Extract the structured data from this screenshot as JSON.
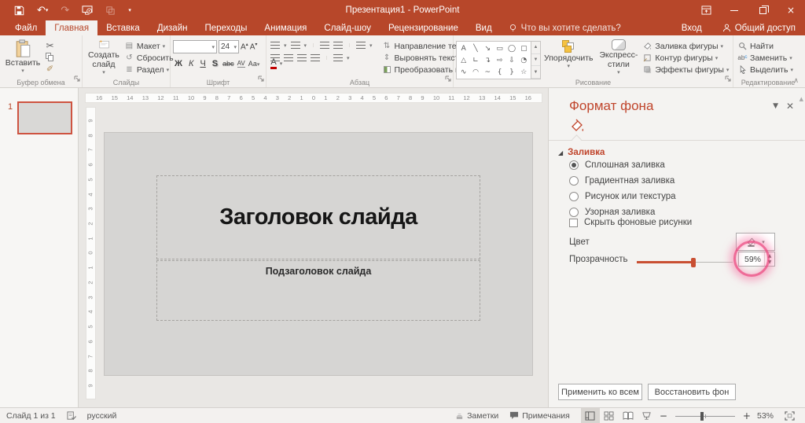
{
  "colors": {
    "accent": "#B7472A",
    "pane_title": "#C0452C",
    "slider_fill": "#C94F32",
    "annotation": "#EC4981"
  },
  "titlebar": {
    "title": "Презентация1 - PowerPoint"
  },
  "tabs": {
    "file": "Файл",
    "items": [
      {
        "label": "Главная",
        "active": true
      },
      {
        "label": "Вставка"
      },
      {
        "label": "Дизайн"
      },
      {
        "label": "Переходы"
      },
      {
        "label": "Анимация"
      },
      {
        "label": "Слайд-шоу"
      },
      {
        "label": "Рецензирование"
      },
      {
        "label": "Вид"
      }
    ],
    "search": "Что вы хотите сделать?",
    "signin": "Вход",
    "share": "Общий доступ"
  },
  "ribbon": {
    "clipboard": {
      "label": "Буфер обмена",
      "paste": "Вставить"
    },
    "slides": {
      "label": "Слайды",
      "new_slide": "Создать слайд",
      "layout": "Макет",
      "reset": "Сбросить",
      "section": "Раздел"
    },
    "font": {
      "label": "Шрифт",
      "size": "24",
      "bold": "Ж",
      "italic": "К",
      "underline": "Ч",
      "shadow": "S",
      "strike": "abc",
      "spacing": "AV",
      "case": "Аа",
      "color": "А"
    },
    "paragraph": {
      "label": "Абзац",
      "direction": "Направление текста",
      "align": "Выровнять текст",
      "smartart": "Преобразовать в SmartArt"
    },
    "drawing": {
      "label": "Рисование",
      "arrange": "Упорядочить",
      "styles": "Экспресс-стили",
      "fill": "Заливка фигуры",
      "outline": "Контур фигуры",
      "effects": "Эффекты фигуры",
      "shapes": [
        {
          "glyph": "A",
          "name": "shape-text-box-icon"
        },
        {
          "glyph": "╲",
          "name": "shape-line-icon"
        },
        {
          "glyph": "↘",
          "name": "shape-arrow-icon"
        },
        {
          "glyph": "▭",
          "name": "shape-rectangle-icon"
        },
        {
          "glyph": "◯",
          "name": "shape-oval-icon"
        },
        {
          "glyph": "▢",
          "name": "shape-rounded-rectangle-icon"
        },
        {
          "glyph": "△",
          "name": "shape-triangle-icon"
        },
        {
          "glyph": "∟",
          "name": "shape-elbow-connector-icon"
        },
        {
          "glyph": "↴",
          "name": "shape-elbow-arrow-icon"
        },
        {
          "glyph": "⇨",
          "name": "shape-right-arrow-icon"
        },
        {
          "glyph": "⇩",
          "name": "shape-down-arrow-icon"
        },
        {
          "glyph": "◔",
          "name": "shape-pie-icon"
        },
        {
          "glyph": "∿",
          "name": "shape-scribble-icon"
        },
        {
          "glyph": "◠",
          "name": "shape-arc-icon"
        },
        {
          "glyph": "~",
          "name": "shape-curve-icon"
        },
        {
          "glyph": "{",
          "name": "shape-left-brace-icon"
        },
        {
          "glyph": "}",
          "name": "shape-right-brace-icon"
        },
        {
          "glyph": "☆",
          "name": "shape-star-icon"
        }
      ]
    },
    "editing": {
      "label": "Редактирование",
      "find": "Найти",
      "replace": "Заменить",
      "select": "Выделить"
    }
  },
  "thumbnails": {
    "slide_number": "1"
  },
  "rulers": {
    "horizontal": [
      "16",
      "15",
      "14",
      "13",
      "12",
      "11",
      "10",
      "9",
      "8",
      "7",
      "6",
      "5",
      "4",
      "3",
      "2",
      "1",
      "0",
      "1",
      "2",
      "3",
      "4",
      "5",
      "6",
      "7",
      "8",
      "9",
      "10",
      "11",
      "12",
      "13",
      "14",
      "15",
      "16"
    ],
    "vertical": [
      "9",
      "8",
      "7",
      "6",
      "5",
      "4",
      "3",
      "2",
      "1",
      "0",
      "1",
      "2",
      "3",
      "4",
      "5",
      "6",
      "7",
      "8",
      "9"
    ]
  },
  "slide": {
    "title": "Заголовок слайда",
    "subtitle": "Подзаголовок слайда"
  },
  "format_pane": {
    "title": "Формат фона",
    "section": "Заливка",
    "fill_options": [
      {
        "label": "Сплошная заливка",
        "active": true
      },
      {
        "label": "Градиентная заливка"
      },
      {
        "label": "Рисунок или текстура"
      },
      {
        "label": "Узорная заливка"
      }
    ],
    "hide_background": "Скрыть фоновые рисунки",
    "color_label": "Цвет",
    "transparency_label": "Прозрачность",
    "transparency_value": "59%",
    "apply_all": "Применить ко всем",
    "reset_background": "Восстановить фон"
  },
  "statusbar": {
    "slide_info": "Слайд 1 из 1",
    "language": "русский",
    "notes": "Заметки",
    "comments": "Примечания",
    "zoom": "53%"
  }
}
